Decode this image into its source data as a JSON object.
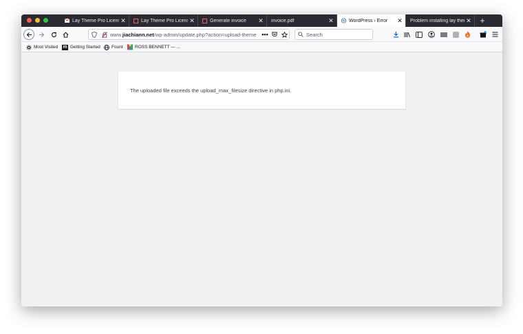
{
  "tabs": [
    {
      "label": "Lay Theme Pro License",
      "favicon": "gmail-icon",
      "active": false
    },
    {
      "label": "Lay Theme Pro License",
      "favicon": "page-icon",
      "active": false
    },
    {
      "label": "Generate invoice",
      "favicon": "page-icon",
      "active": false
    },
    {
      "label": "invoice.pdf",
      "favicon": "",
      "active": false
    },
    {
      "label": "WordPress › Error",
      "favicon": "wordpress-icon",
      "active": true
    },
    {
      "label": "Problem installing lay theme",
      "favicon": "",
      "active": false
    }
  ],
  "url": {
    "prefix": "www.",
    "domain": "jiachiann.net",
    "path": "/wp-admin/update.php?action=upload-theme"
  },
  "search": {
    "placeholder": "Search"
  },
  "bookmarks": [
    {
      "label": "Most Visited",
      "icon": "gear-icon"
    },
    {
      "label": "Getting Started",
      "icon": "m-logo-icon"
    },
    {
      "label": "Fount",
      "icon": "globe-icon"
    },
    {
      "label": "ROSS BENNETT — ...",
      "icon": "color-bars-icon"
    }
  ],
  "error": {
    "message": "The uploaded file exceeds the upload_max_filesize directive in php.ini."
  },
  "colors": {
    "tabbar": "#2b2a33",
    "active_tab": "#ffffff",
    "page_bg": "#f1f1f1",
    "download_accent": "#0060df"
  }
}
